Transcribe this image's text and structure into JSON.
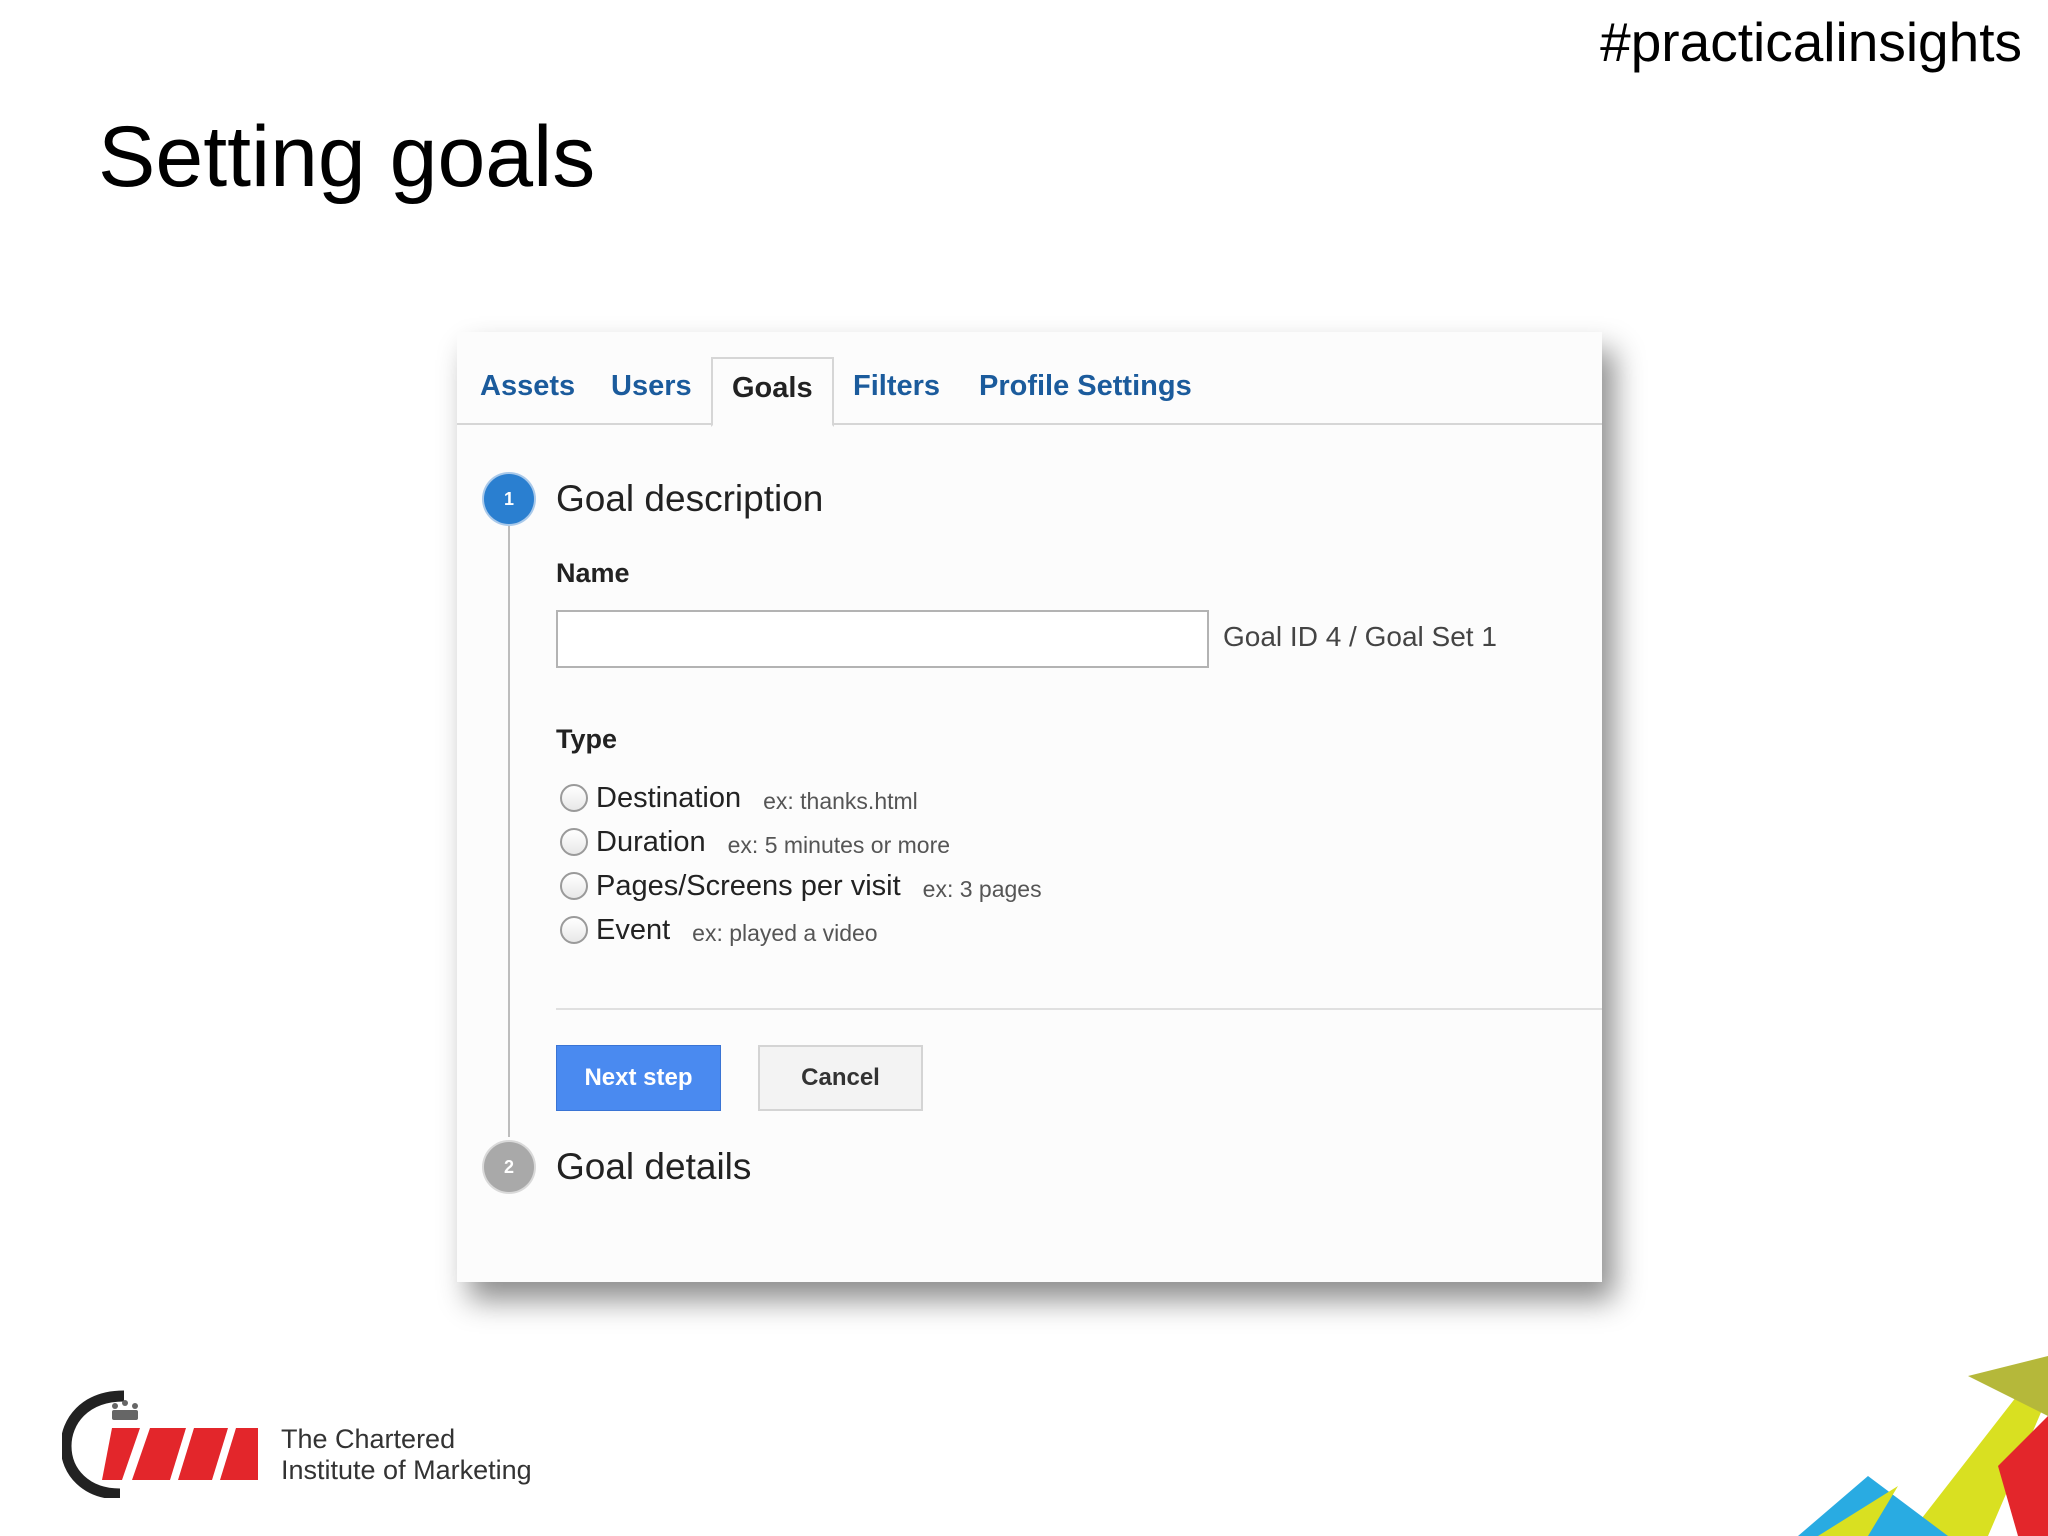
{
  "slide": {
    "hashtag": "#practicalinsights",
    "title": "Setting goals"
  },
  "tabs": [
    {
      "label": "Assets",
      "active": false
    },
    {
      "label": "Users",
      "active": false
    },
    {
      "label": "Goals",
      "active": true
    },
    {
      "label": "Filters",
      "active": false
    },
    {
      "label": "Profile Settings",
      "active": false
    }
  ],
  "step1": {
    "number": "1",
    "heading": "Goal description",
    "name_label": "Name",
    "name_value": "",
    "goal_id": "Goal ID 4 / Goal Set 1",
    "type_label": "Type",
    "options": [
      {
        "label": "Destination",
        "example": "ex: thanks.html"
      },
      {
        "label": "Duration",
        "example": "ex: 5 minutes or more"
      },
      {
        "label": "Pages/Screens per visit",
        "example": "ex: 3 pages"
      },
      {
        "label": "Event",
        "example": "ex: played a video"
      }
    ],
    "next_label": "Next step",
    "cancel_label": "Cancel"
  },
  "step2": {
    "number": "2",
    "heading": "Goal details"
  },
  "logo": {
    "line1": "The Chartered",
    "line2": "Institute of Marketing"
  },
  "colors": {
    "tab_link": "#1b5b9c",
    "step_active": "#2a7fd0",
    "step_inactive": "#a9a9a9",
    "primary_button": "#4a8af0",
    "logo_red": "#e3262b"
  }
}
